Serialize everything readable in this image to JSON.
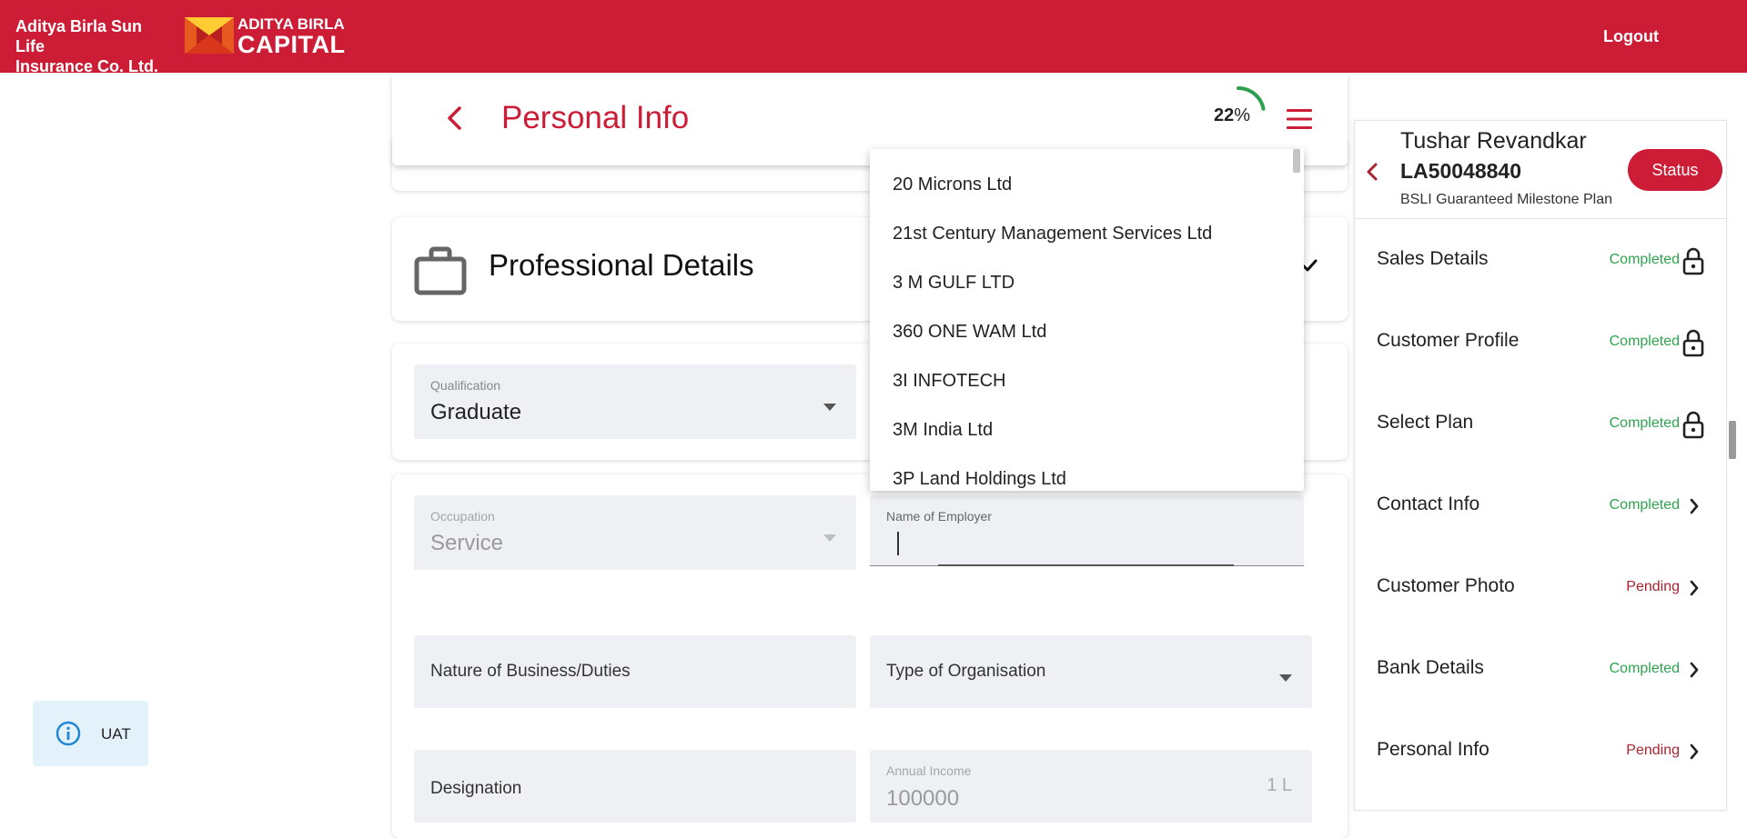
{
  "header": {
    "brand_line1": "Aditya Birla Sun Life",
    "brand_line2": "Insurance Co. Ltd.",
    "logo_line1": "ADITYA BIRLA",
    "logo_line2": "CAPITAL",
    "logout_label": "Logout",
    "color": "#cd1c35"
  },
  "page": {
    "title": "Personal Info",
    "progress_value": "22",
    "progress_unit": "%",
    "progress_fraction": 0.22
  },
  "section": {
    "title": "Professional Details"
  },
  "fields": {
    "qualification": {
      "label": "Qualification",
      "value": "Graduate"
    },
    "occupation": {
      "label": "Occupation",
      "value": "Service"
    },
    "employer": {
      "label": "Name of Employer",
      "value": ""
    },
    "nature": {
      "placeholder": "Nature of Business/Duties"
    },
    "organisation": {
      "placeholder": "Type of Organisation"
    },
    "designation": {
      "placeholder": "Designation"
    },
    "income": {
      "label": "Annual Income",
      "value": "100000",
      "suffix": "1 L"
    }
  },
  "dropdown": {
    "options": [
      "20 Microns Ltd",
      "21st Century Management Services Ltd",
      "3 M GULF LTD",
      "360 ONE WAM Ltd",
      "3I INFOTECH",
      "3M India Ltd",
      "3P Land Holdings Ltd"
    ]
  },
  "env_badge": {
    "label": "UAT"
  },
  "sidebar": {
    "customer_name": "Tushar Revandkar",
    "application_id": "LA50048840",
    "plan_name": "BSLI Guaranteed Milestone Plan",
    "status_label": "Status",
    "items": [
      {
        "label": "Sales Details",
        "status": "Completed",
        "icon": "lock-icon"
      },
      {
        "label": "Customer Profile",
        "status": "Completed",
        "icon": "lock-icon"
      },
      {
        "label": "Select Plan",
        "status": "Completed",
        "icon": "lock-icon"
      },
      {
        "label": "Contact Info",
        "status": "Completed",
        "icon": "chevron-right-icon"
      },
      {
        "label": "Customer Photo",
        "status": "Pending",
        "icon": "chevron-right-icon"
      },
      {
        "label": "Bank Details",
        "status": "Completed",
        "icon": "chevron-right-icon"
      },
      {
        "label": "Personal Info",
        "status": "Pending",
        "icon": "chevron-right-icon"
      }
    ]
  }
}
